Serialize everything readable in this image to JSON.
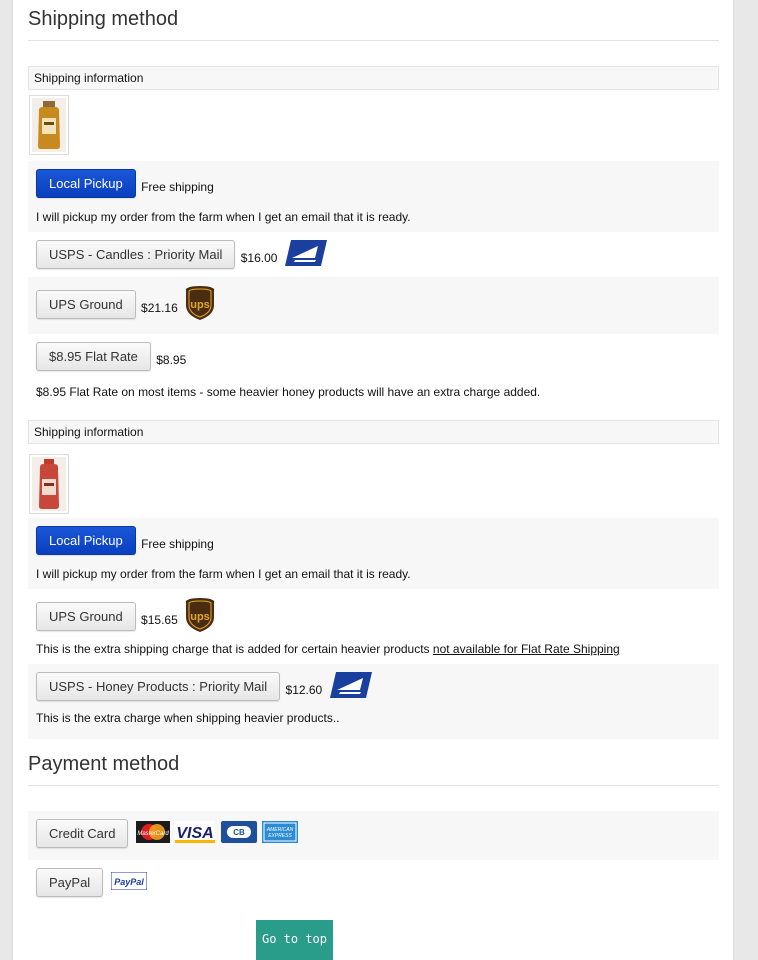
{
  "shipping": {
    "title": "Shipping method",
    "groups": [
      {
        "info_label": "Shipping information",
        "options": [
          {
            "label": "Local Pickup",
            "price": "Free shipping",
            "desc": "I will pickup my order from the farm when I get an email that it is ready."
          },
          {
            "label": "USPS - Candles : Priority Mail",
            "price": "$16.00",
            "logo": "usps-icon"
          },
          {
            "label": "UPS Ground",
            "price": "$21.16",
            "logo": "ups-icon"
          },
          {
            "label": "$8.95 Flat Rate",
            "price": "$8.95",
            "desc": "$8.95 Flat Rate on most items - some heavier honey products will have an extra charge added."
          }
        ]
      },
      {
        "info_label": "Shipping information",
        "options": [
          {
            "label": "Local Pickup",
            "price": "Free shipping",
            "desc": "I will pickup my order from the farm when I get an email that it is ready."
          },
          {
            "label": "UPS Ground",
            "price": "$15.65",
            "logo": "ups-icon",
            "desc": "This is the extra shipping charge that is added for certain heavier products",
            "desc_link": "not available for Flat Rate Shipping"
          },
          {
            "label": "USPS - Honey Products : Priority Mail",
            "price": "$12.60",
            "logo": "usps-icon",
            "desc": "This is the extra charge when shipping heavier products.."
          }
        ]
      }
    ]
  },
  "payment": {
    "title": "Payment method",
    "credit_card_label": "Credit Card",
    "paypal_label": "PayPal",
    "card_logos": [
      "mastercard-icon",
      "visa-icon",
      "cb-icon",
      "american-express-icon"
    ]
  },
  "go_to_top": "Go to top"
}
